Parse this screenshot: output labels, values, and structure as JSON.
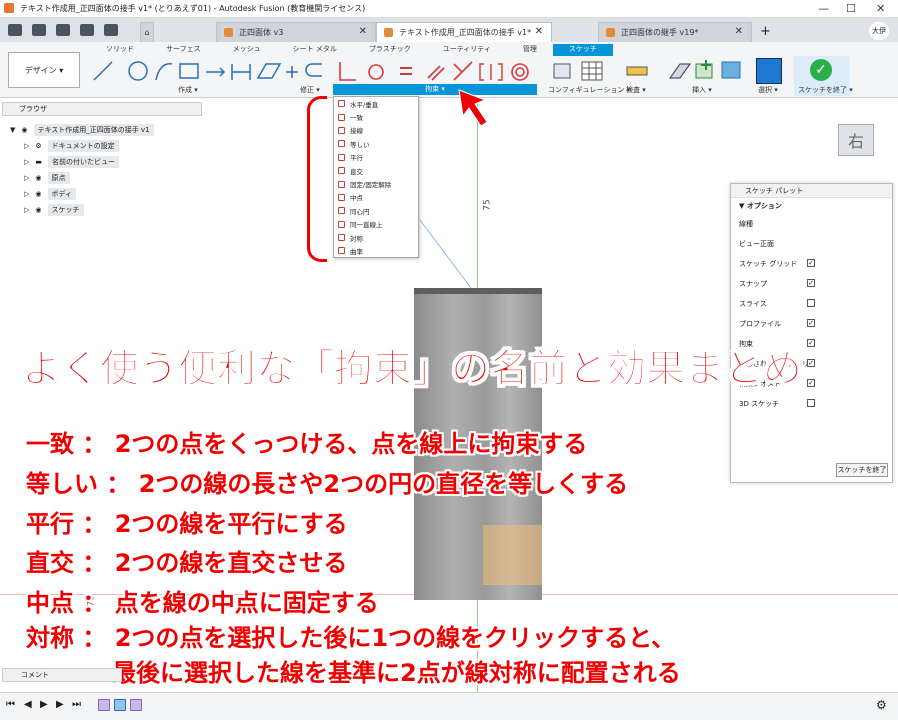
{
  "window": {
    "title": "テキスト作成用_正四面体の接手 v1* (とりあえず01) - Autodesk Fusion (教育機関ライセンス)",
    "min": "—",
    "max": "☐",
    "close": "✕"
  },
  "doc_tabs": [
    {
      "label": "正四面体 v3"
    },
    {
      "label": "テキスト作成用_正四面体の接手 v1*"
    },
    {
      "label": "正四面体の継手 v19*"
    }
  ],
  "user_avatar": "大伊",
  "workspace_tabs": [
    "ソリッド",
    "サーフェス",
    "メッシュ",
    "シート メタル",
    "プラスチック",
    "ユーティリティ",
    "管理",
    "スケッチ"
  ],
  "design_button": "デザイン ▾",
  "groups": {
    "create": "作成 ▾",
    "modify": "修正 ▾",
    "constraints": "拘束 ▾",
    "config": "コンフィギュレーション ▾",
    "inspect": "検査 ▾",
    "insert": "挿入 ▾",
    "select": "選択 ▾",
    "finish": "スケッチを終了 ▾"
  },
  "browser": {
    "title": "ブラウザ",
    "root": "テキスト作成用_正四面体の接手 v1",
    "items": [
      "ドキュメントの設定",
      "名前の付いたビュー",
      "原点",
      "ボディ",
      "スケッチ"
    ]
  },
  "constraint_menu": [
    "水平/垂直",
    "一致",
    "接線",
    "等しい",
    "平行",
    "直交",
    "固定/固定解除",
    "中点",
    "同心円",
    "同一直線上",
    "対称",
    "曲率"
  ],
  "dimension_label": "75",
  "dimension_label2": "75",
  "viewcube_label": "右",
  "palette": {
    "title": "スケッチ パレット",
    "section": "オプション",
    "rows": [
      {
        "label": "線種",
        "checked": null
      },
      {
        "label": "ビュー正面",
        "checked": null
      },
      {
        "label": "スケッチ グリッド",
        "checked": true
      },
      {
        "label": "スナップ",
        "checked": true
      },
      {
        "label": "スライス",
        "checked": false
      },
      {
        "label": "プロファイル",
        "checked": true
      },
      {
        "label": "拘束",
        "checked": true
      },
      {
        "label": "投影されたジオメトリ",
        "checked": true
      },
      {
        "label": "構築ジオメトリ",
        "checked": true
      },
      {
        "label": "3D スケッチ",
        "checked": false
      }
    ],
    "finish_button": "スケッチを終了"
  },
  "overlay": {
    "headline": "よく使う便利な「拘束」の名前と効果まとめ",
    "lines": [
      "一致 ： 2つの点をくっつける、点を線上に拘束する",
      "等しい ： 2つの線の長さや2つの円の直径を等しくする",
      "平行 ： 2つの線を平行にする",
      "直交 ： 2つの線を直交させる",
      "中点 ： 点を線の中点に固定する",
      "対称 ： 2つの点を選択した後に1つの線をクリックすると、",
      "最後に選択した線を基準に2点が線対称に配置される"
    ]
  },
  "comment_label": "コメント",
  "colors": {
    "accent": "#0696d7",
    "annotation": "#e00000"
  }
}
